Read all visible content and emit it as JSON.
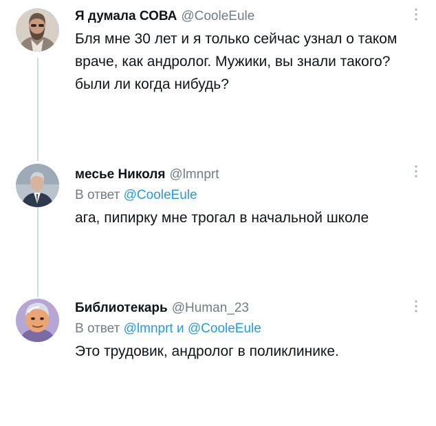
{
  "tweets": [
    {
      "author_name": "Я думала СОВА",
      "author_handle": "@CooleEule",
      "text": "Бля мне 30 лет и я только сейчас узнал о таком враче, как андролог. Мужики, вы знали такого? были ли когда нибудь?",
      "avatar_icon": "bearded-man-avatar-icon",
      "more_icon": "more-options-vertical-icon"
    },
    {
      "author_name": "месье Николя",
      "author_handle": "@lmnprt",
      "reply_prefix": "В ответ",
      "reply_to_1": "@CooleEule",
      "text": "ага, пипирку мне трогал в начальной школе",
      "avatar_icon": "man-in-suit-avatar-icon",
      "more_icon": "more-options-vertical-icon"
    },
    {
      "author_name": "Библиотекарь",
      "author_handle": "@Human_23",
      "reply_prefix": "В ответ",
      "reply_to_1": "@lmnprt",
      "reply_joiner": "и",
      "reply_to_2": "@CooleEule",
      "text": "Это трудовик, андролог в поликлинике.",
      "avatar_icon": "cartoon-character-avatar-icon",
      "more_icon": "more-options-vertical-icon"
    }
  ],
  "colors": {
    "text": "#0f1419",
    "secondary": "#6f7d87",
    "link": "#1d9bf0",
    "thread_line": "#cfd9de"
  }
}
